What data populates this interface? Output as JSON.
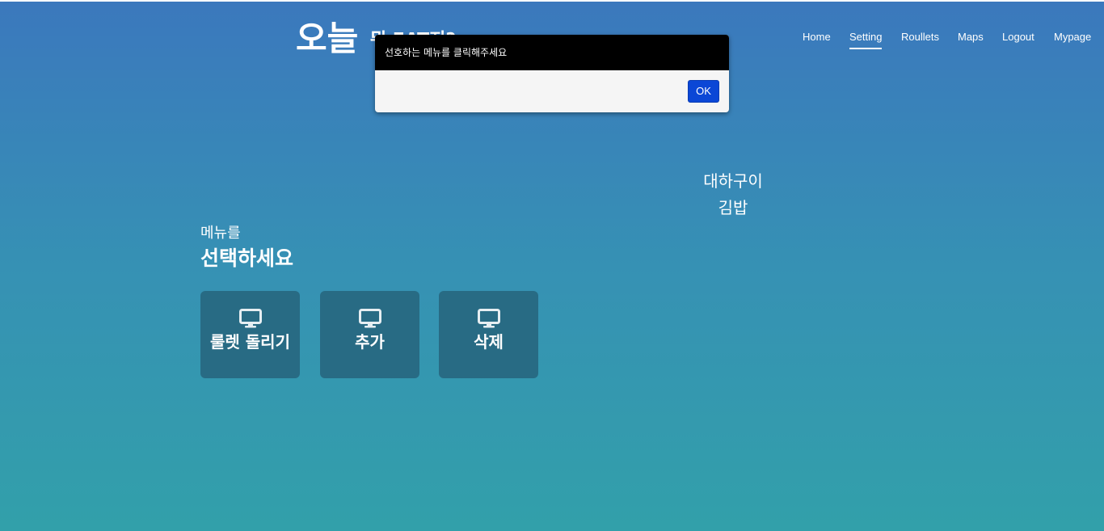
{
  "header": {
    "title_main": "오늘",
    "title_rest": "뭐 EAT지?"
  },
  "nav": {
    "items": [
      {
        "label": "Home"
      },
      {
        "label": "Setting",
        "active": true
      },
      {
        "label": "Roullets"
      },
      {
        "label": "Maps"
      },
      {
        "label": "Logout"
      },
      {
        "label": "Mypage"
      }
    ]
  },
  "menu": {
    "subtitle": "메뉴를",
    "title": "선택하세요",
    "tiles": [
      {
        "label": "룰렛 돌리기",
        "icon": "monitor-icon"
      },
      {
        "label": "추가",
        "icon": "monitor-icon"
      },
      {
        "label": "삭제",
        "icon": "monitor-icon"
      }
    ]
  },
  "selected_items": [
    "대하구이",
    "김밥"
  ],
  "dialog": {
    "message": "선호하는 메뉴를 클릭해주세요",
    "ok_label": "OK"
  },
  "colors": {
    "tile_bg": "#286b84",
    "dialog_header": "#000000",
    "ok_button": "#0b47d6"
  }
}
